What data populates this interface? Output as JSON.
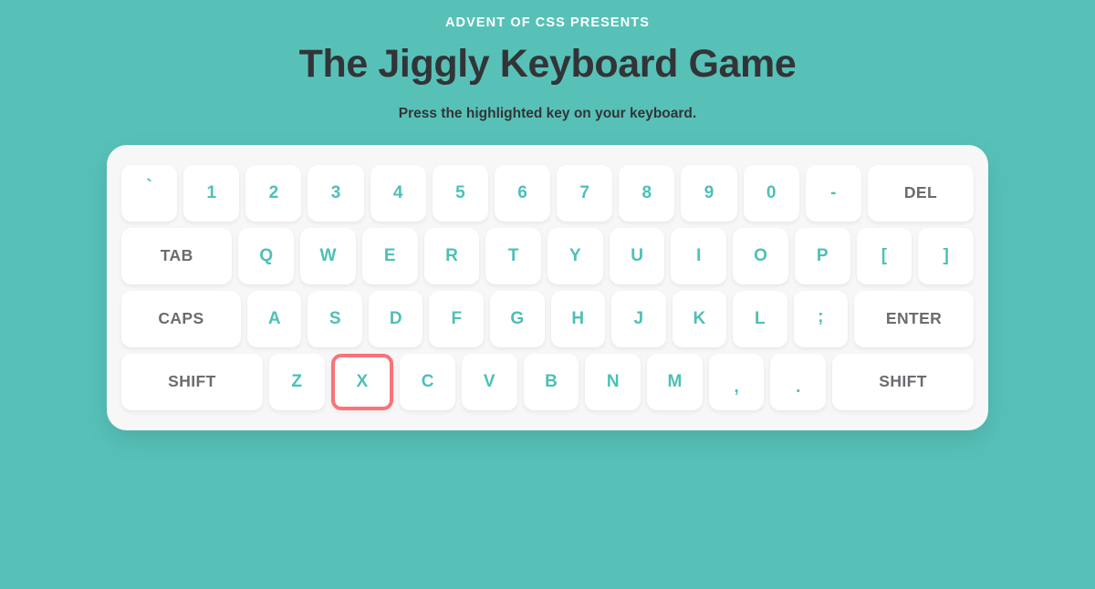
{
  "header": {
    "eyebrow": "ADVENT OF CSS PRESENTS",
    "title": "The Jiggly Keyboard Game",
    "instructions": "Press the highlighted key on your keyboard."
  },
  "theme": {
    "background": "#57c1b8",
    "panel": "#f7f7f7",
    "key_background": "#ffffff",
    "key_text": "#4dc0b5",
    "modifier_text": "#6b6b70",
    "title_text": "#333437",
    "highlight_border": "#f9737a"
  },
  "game": {
    "highlighted_key": "X"
  },
  "keyboard": {
    "rows": [
      {
        "name": "row-number",
        "keys": [
          {
            "label": "`",
            "type": "char"
          },
          {
            "label": "1",
            "type": "char"
          },
          {
            "label": "2",
            "type": "char"
          },
          {
            "label": "3",
            "type": "char"
          },
          {
            "label": "4",
            "type": "char"
          },
          {
            "label": "5",
            "type": "char"
          },
          {
            "label": "6",
            "type": "char"
          },
          {
            "label": "7",
            "type": "char"
          },
          {
            "label": "8",
            "type": "char"
          },
          {
            "label": "9",
            "type": "char"
          },
          {
            "label": "0",
            "type": "char"
          },
          {
            "label": "-",
            "type": "char"
          },
          {
            "label": "DEL",
            "type": "modifier"
          }
        ]
      },
      {
        "name": "row-top",
        "keys": [
          {
            "label": "TAB",
            "type": "modifier"
          },
          {
            "label": "Q",
            "type": "char"
          },
          {
            "label": "W",
            "type": "char"
          },
          {
            "label": "E",
            "type": "char"
          },
          {
            "label": "R",
            "type": "char"
          },
          {
            "label": "T",
            "type": "char"
          },
          {
            "label": "Y",
            "type": "char"
          },
          {
            "label": "U",
            "type": "char"
          },
          {
            "label": "I",
            "type": "char"
          },
          {
            "label": "O",
            "type": "char"
          },
          {
            "label": "P",
            "type": "char"
          },
          {
            "label": "[",
            "type": "char"
          },
          {
            "label": "]",
            "type": "char"
          }
        ]
      },
      {
        "name": "row-home",
        "keys": [
          {
            "label": "CAPS",
            "type": "modifier"
          },
          {
            "label": "A",
            "type": "char"
          },
          {
            "label": "S",
            "type": "char"
          },
          {
            "label": "D",
            "type": "char"
          },
          {
            "label": "F",
            "type": "char"
          },
          {
            "label": "G",
            "type": "char"
          },
          {
            "label": "H",
            "type": "char"
          },
          {
            "label": "J",
            "type": "char"
          },
          {
            "label": "K",
            "type": "char"
          },
          {
            "label": "L",
            "type": "char"
          },
          {
            "label": ";",
            "type": "char"
          },
          {
            "label": "ENTER",
            "type": "modifier"
          }
        ]
      },
      {
        "name": "row-bottom",
        "keys": [
          {
            "label": "SHIFT",
            "type": "modifier"
          },
          {
            "label": "Z",
            "type": "char"
          },
          {
            "label": "X",
            "type": "char"
          },
          {
            "label": "C",
            "type": "char"
          },
          {
            "label": "V",
            "type": "char"
          },
          {
            "label": "B",
            "type": "char"
          },
          {
            "label": "N",
            "type": "char"
          },
          {
            "label": "M",
            "type": "char"
          },
          {
            "label": ",",
            "type": "char"
          },
          {
            "label": ".",
            "type": "char"
          },
          {
            "label": "SHIFT",
            "type": "modifier"
          }
        ]
      }
    ]
  }
}
